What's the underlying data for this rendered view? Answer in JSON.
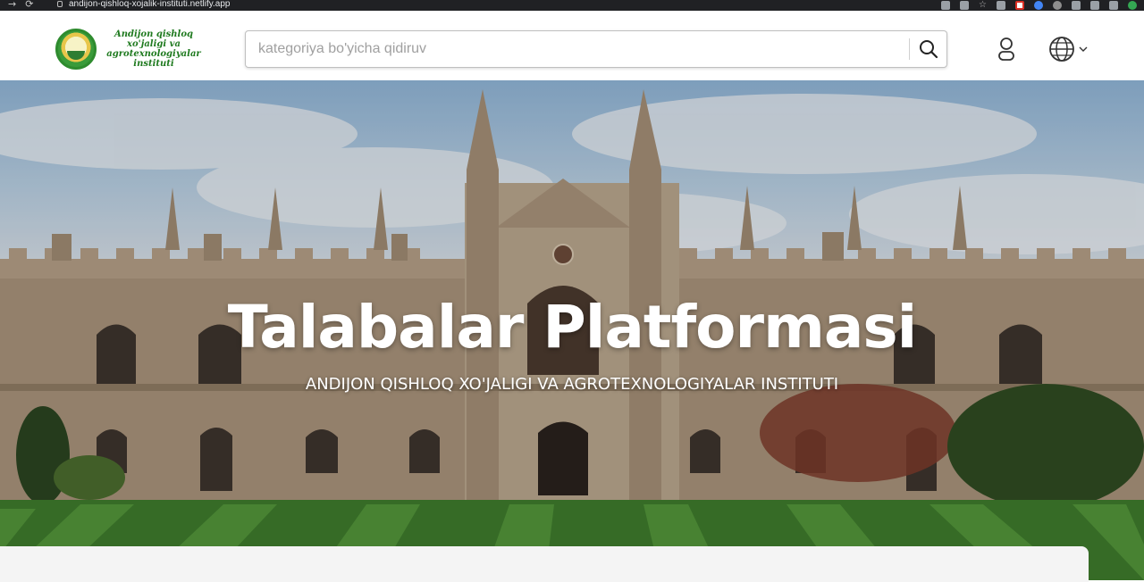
{
  "browser": {
    "url": "andijon-qishloq-xojalik-instituti.netlify.app"
  },
  "header": {
    "logo_text": "Andijon qishloq xo'jaligi va agrotexnologiyalar instituti",
    "search_placeholder": "kategoriya bo'yicha qidiruv",
    "search_value": "",
    "icons": [
      "search-icon",
      "user-icon",
      "globe-icon",
      "chevron-down-icon"
    ]
  },
  "hero": {
    "title": "Talabalar Platformasi",
    "subtitle": "ANDIJON QISHLOQ XO'JALIGI VA AGROTEXNOLOGIYALAR INSTITUTI"
  },
  "colors": {
    "header_bg": "#ffffff",
    "logo_green": "#1f7a1f",
    "hero_text": "#ffffff",
    "browser_bar": "#202124"
  }
}
